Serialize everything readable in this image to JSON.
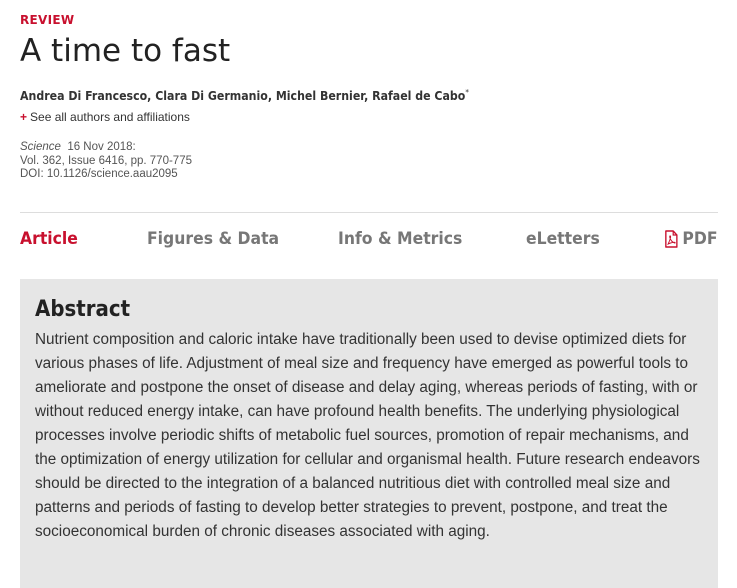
{
  "article": {
    "kicker": "REVIEW",
    "title": "A time to fast",
    "authors": "Andrea Di Francesco, Clara Di Germanio, Michel Bernier, Rafael de Cabo",
    "corresponding_mark": "*",
    "see_all_plus": "+",
    "see_all_label": "See all authors and affiliations",
    "journal": "Science",
    "date": "16 Nov 2018:",
    "volume_issue_pages": "Vol. 362, Issue 6416, pp. 770-775",
    "doi": "DOI: 10.1126/science.aau2095"
  },
  "tabs": [
    {
      "label": "Article",
      "active": true
    },
    {
      "label": "Figures & Data",
      "active": false
    },
    {
      "label": "Info & Metrics",
      "active": false
    },
    {
      "label": "eLetters",
      "active": false
    },
    {
      "label": "PDF",
      "active": false,
      "icon": "pdf-icon"
    }
  ],
  "abstract": {
    "heading": "Abstract",
    "text": "Nutrient composition and caloric intake have traditionally been used to devise optimized diets for various phases of life. Adjustment of meal size and frequency have emerged as powerful tools to ameliorate and postpone the onset of disease and delay aging, whereas periods of fasting, with or without reduced energy intake, can have profound health benefits. The underlying physiological processes involve periodic shifts of metabolic fuel sources, promotion of repair mechanisms, and the optimization of energy utilization for cellular and organismal health. Future research endeavors should be directed to the integration of a balanced nutritious diet with controlled meal size and patterns and periods of fasting to develop better strategies to prevent, postpone, and treat the socioeconomical burden of chronic diseases associated with aging."
  },
  "colors": {
    "accent": "#c8102e",
    "abstract_background": "#e6e6e6",
    "inactive_tab": "#777777"
  }
}
